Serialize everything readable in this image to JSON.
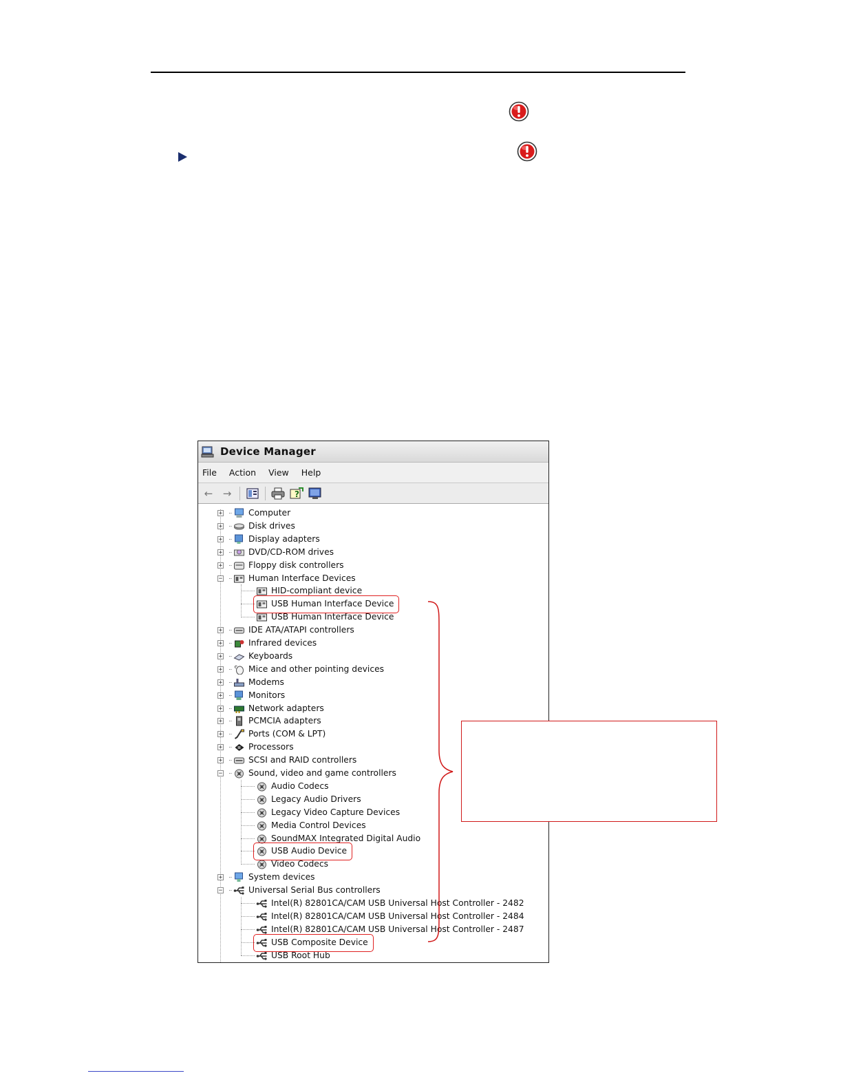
{
  "window": {
    "title": "Device Manager",
    "menus": [
      "File",
      "Action",
      "View",
      "Help"
    ]
  },
  "toolbar": {
    "icons": [
      "back-arrow-icon",
      "forward-arrow-icon",
      "properties-icon",
      "print-icon",
      "help-icon",
      "monitor-icon"
    ]
  },
  "tree": [
    {
      "label": "Computer",
      "icon": "computer-icon",
      "level": 0,
      "state": "collapsed"
    },
    {
      "label": "Disk drives",
      "icon": "disk-icon",
      "level": 0,
      "state": "collapsed"
    },
    {
      "label": "Display adapters",
      "icon": "display-icon",
      "level": 0,
      "state": "collapsed"
    },
    {
      "label": "DVD/CD-ROM drives",
      "icon": "cdrom-icon",
      "level": 0,
      "state": "collapsed"
    },
    {
      "label": "Floppy disk controllers",
      "icon": "floppy-icon",
      "level": 0,
      "state": "collapsed"
    },
    {
      "label": "Human Interface Devices",
      "icon": "hid-icon",
      "level": 0,
      "state": "expanded"
    },
    {
      "label": "HID-compliant device",
      "icon": "hid-icon",
      "level": 1
    },
    {
      "label": "USB Human Interface Device",
      "icon": "hid-icon",
      "level": 1,
      "highlighted": true
    },
    {
      "label": "USB Human Interface Device",
      "icon": "hid-icon",
      "level": 1
    },
    {
      "label": "IDE ATA/ATAPI controllers",
      "icon": "ide-icon",
      "level": 0,
      "state": "collapsed"
    },
    {
      "label": "Infrared devices",
      "icon": "infrared-icon",
      "level": 0,
      "state": "collapsed"
    },
    {
      "label": "Keyboards",
      "icon": "keyboard-icon",
      "level": 0,
      "state": "collapsed"
    },
    {
      "label": "Mice and other pointing devices",
      "icon": "mouse-icon",
      "level": 0,
      "state": "collapsed"
    },
    {
      "label": "Modems",
      "icon": "modem-icon",
      "level": 0,
      "state": "collapsed"
    },
    {
      "label": "Monitors",
      "icon": "monitor-icon",
      "level": 0,
      "state": "collapsed"
    },
    {
      "label": "Network adapters",
      "icon": "network-icon",
      "level": 0,
      "state": "collapsed"
    },
    {
      "label": "PCMCIA adapters",
      "icon": "pcmcia-icon",
      "level": 0,
      "state": "collapsed"
    },
    {
      "label": "Ports (COM & LPT)",
      "icon": "port-icon",
      "level": 0,
      "state": "collapsed"
    },
    {
      "label": "Processors",
      "icon": "processor-icon",
      "level": 0,
      "state": "collapsed"
    },
    {
      "label": "SCSI and RAID controllers",
      "icon": "scsi-icon",
      "level": 0,
      "state": "collapsed"
    },
    {
      "label": "Sound, video and game controllers",
      "icon": "sound-icon",
      "level": 0,
      "state": "expanded"
    },
    {
      "label": "Audio Codecs",
      "icon": "sound-icon",
      "level": 1
    },
    {
      "label": "Legacy Audio Drivers",
      "icon": "sound-icon",
      "level": 1
    },
    {
      "label": "Legacy Video Capture Devices",
      "icon": "sound-icon",
      "level": 1
    },
    {
      "label": "Media Control Devices",
      "icon": "sound-icon",
      "level": 1
    },
    {
      "label": "SoundMAX Integrated Digital Audio",
      "icon": "sound-icon",
      "level": 1
    },
    {
      "label": "USB Audio Device",
      "icon": "sound-icon",
      "level": 1,
      "highlighted": true
    },
    {
      "label": "Video Codecs",
      "icon": "sound-icon",
      "level": 1
    },
    {
      "label": "System devices",
      "icon": "system-icon",
      "level": 0,
      "state": "collapsed"
    },
    {
      "label": "Universal Serial Bus controllers",
      "icon": "usb-icon",
      "level": 0,
      "state": "expanded"
    },
    {
      "label": "Intel(R) 82801CA/CAM USB Universal Host Controller - 2482",
      "icon": "usb-icon",
      "level": 1
    },
    {
      "label": "Intel(R) 82801CA/CAM USB Universal Host Controller - 2484",
      "icon": "usb-icon",
      "level": 1
    },
    {
      "label": "Intel(R) 82801CA/CAM USB Universal Host Controller - 2487",
      "icon": "usb-icon",
      "level": 1
    },
    {
      "label": "USB Composite Device",
      "icon": "usb-icon",
      "level": 1,
      "highlighted": true
    },
    {
      "label": "USB Root Hub",
      "icon": "usb-icon",
      "level": 1
    }
  ],
  "colors": {
    "highlight": "#e02020",
    "bullet": "#1a2e6e",
    "warning": "#d91c1c"
  }
}
